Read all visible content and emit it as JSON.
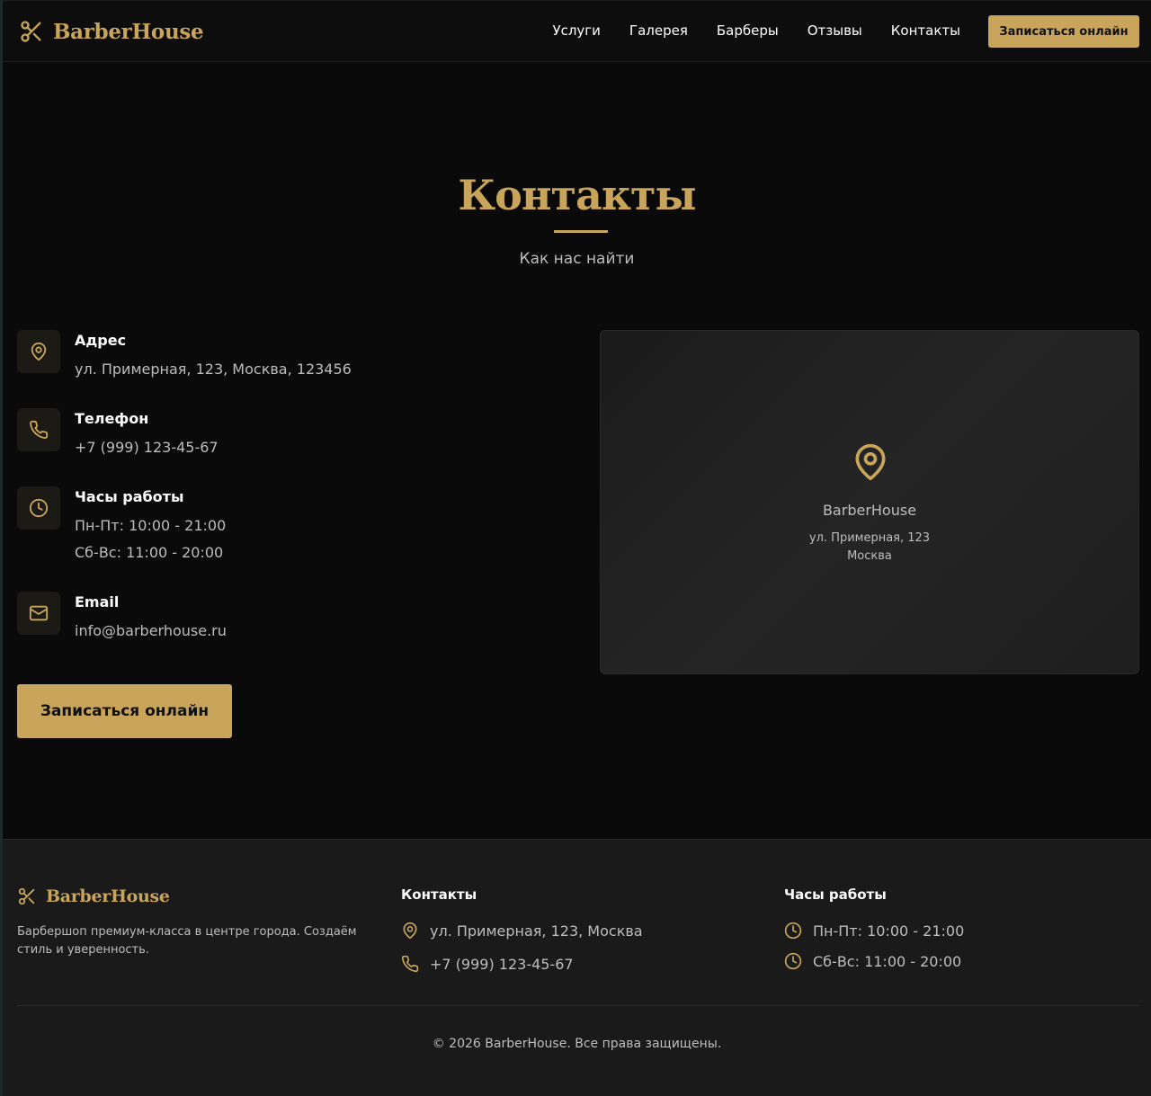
{
  "brand": {
    "name": "BarberHouse"
  },
  "nav": {
    "items": [
      "Услуги",
      "Галерея",
      "Барберы",
      "Отзывы",
      "Контакты"
    ],
    "cta": "Записаться онлайн"
  },
  "hero": {
    "title": "Контакты",
    "subtitle": "Как нас найти"
  },
  "contacts": {
    "address": {
      "label": "Адрес",
      "value": "ул. Примерная, 123, Москва, 123456"
    },
    "phone": {
      "label": "Телефон",
      "value": "+7 (999) 123-45-67"
    },
    "hours": {
      "label": "Часы работы",
      "weekdays": "Пн-Пт: 10:00 - 21:00",
      "weekend": "Сб-Вс: 11:00 - 20:00"
    },
    "email": {
      "label": "Email",
      "value": "info@barberhouse.ru"
    },
    "button": "Записаться онлайн"
  },
  "map": {
    "name": "BarberHouse",
    "street": "ул. Примерная, 123",
    "city": "Москва"
  },
  "footer": {
    "brand": "BarberHouse",
    "description": "Барбершоп премиум-класса в центре города. Создаём стиль и уверенность.",
    "contacts_title": "Контакты",
    "address": "ул. Примерная, 123, Москва",
    "phone": "+7 (999) 123-45-67",
    "hours_title": "Часы работы",
    "weekdays": "Пн-Пт: 10:00 - 21:00",
    "weekend": "Сб-Вс: 11:00 - 20:00",
    "copyright": "© 2026 BarberHouse. Все права защищены."
  },
  "colors": {
    "accent": "#c9a55c",
    "background": "#0a0a0a",
    "footer": "#1a1a1a",
    "muted": "#bdbdbd"
  }
}
